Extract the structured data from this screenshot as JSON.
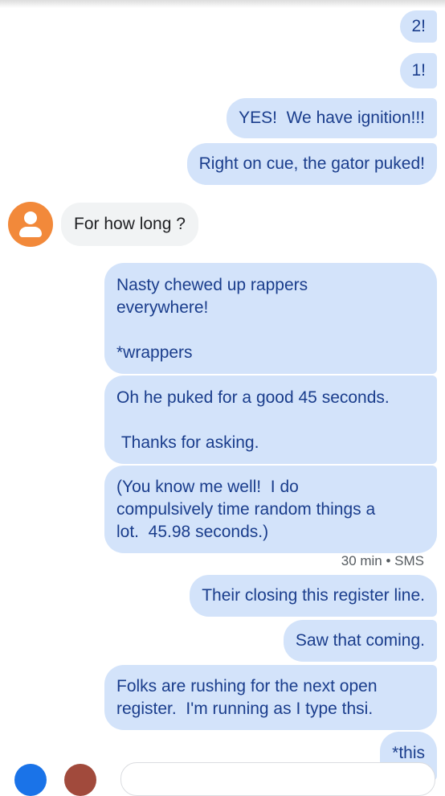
{
  "conversation": {
    "messages": [
      {
        "id": "m1",
        "direction": "outgoing",
        "text": "2!"
      },
      {
        "id": "m2",
        "direction": "outgoing",
        "text": "1!"
      },
      {
        "id": "m3",
        "direction": "outgoing",
        "text": "YES!  We have ignition!!!"
      },
      {
        "id": "m4",
        "direction": "outgoing",
        "text": "Right on cue, the gator puked!"
      },
      {
        "id": "m5",
        "direction": "incoming",
        "text": "For how long ?"
      },
      {
        "id": "m6",
        "direction": "outgoing",
        "text": "Nasty chewed up rappers\neverywhere!\n\n*wrappers"
      },
      {
        "id": "m7",
        "direction": "outgoing",
        "text": "Oh he puked for a good 45 seconds.\n\n Thanks for asking."
      },
      {
        "id": "m8",
        "direction": "outgoing",
        "text": "(You know me well!  I do\ncompulsively time random things a\nlot.  45.98 seconds.)"
      },
      {
        "id": "m9",
        "direction": "outgoing",
        "text": "Their closing this register line."
      },
      {
        "id": "m10",
        "direction": "outgoing",
        "text": "Saw that coming."
      },
      {
        "id": "m11",
        "direction": "outgoing",
        "text": "Folks are rushing for the next open\nregister.  I'm running as I type thsi."
      },
      {
        "id": "m12",
        "direction": "outgoing",
        "text": "*this"
      }
    ],
    "timestamp_label": "30 min • SMS"
  },
  "contact": {
    "avatar_icon": "person-icon",
    "avatar_color": "#f2893a"
  },
  "colors": {
    "outgoing_bubble": "#d3e3fa",
    "outgoing_text": "#1a3d8c",
    "incoming_bubble": "#f1f3f4",
    "incoming_text": "#202124"
  },
  "composer": {
    "left_button_icon": "add-icon",
    "second_button_icon": "attachment-icon"
  }
}
